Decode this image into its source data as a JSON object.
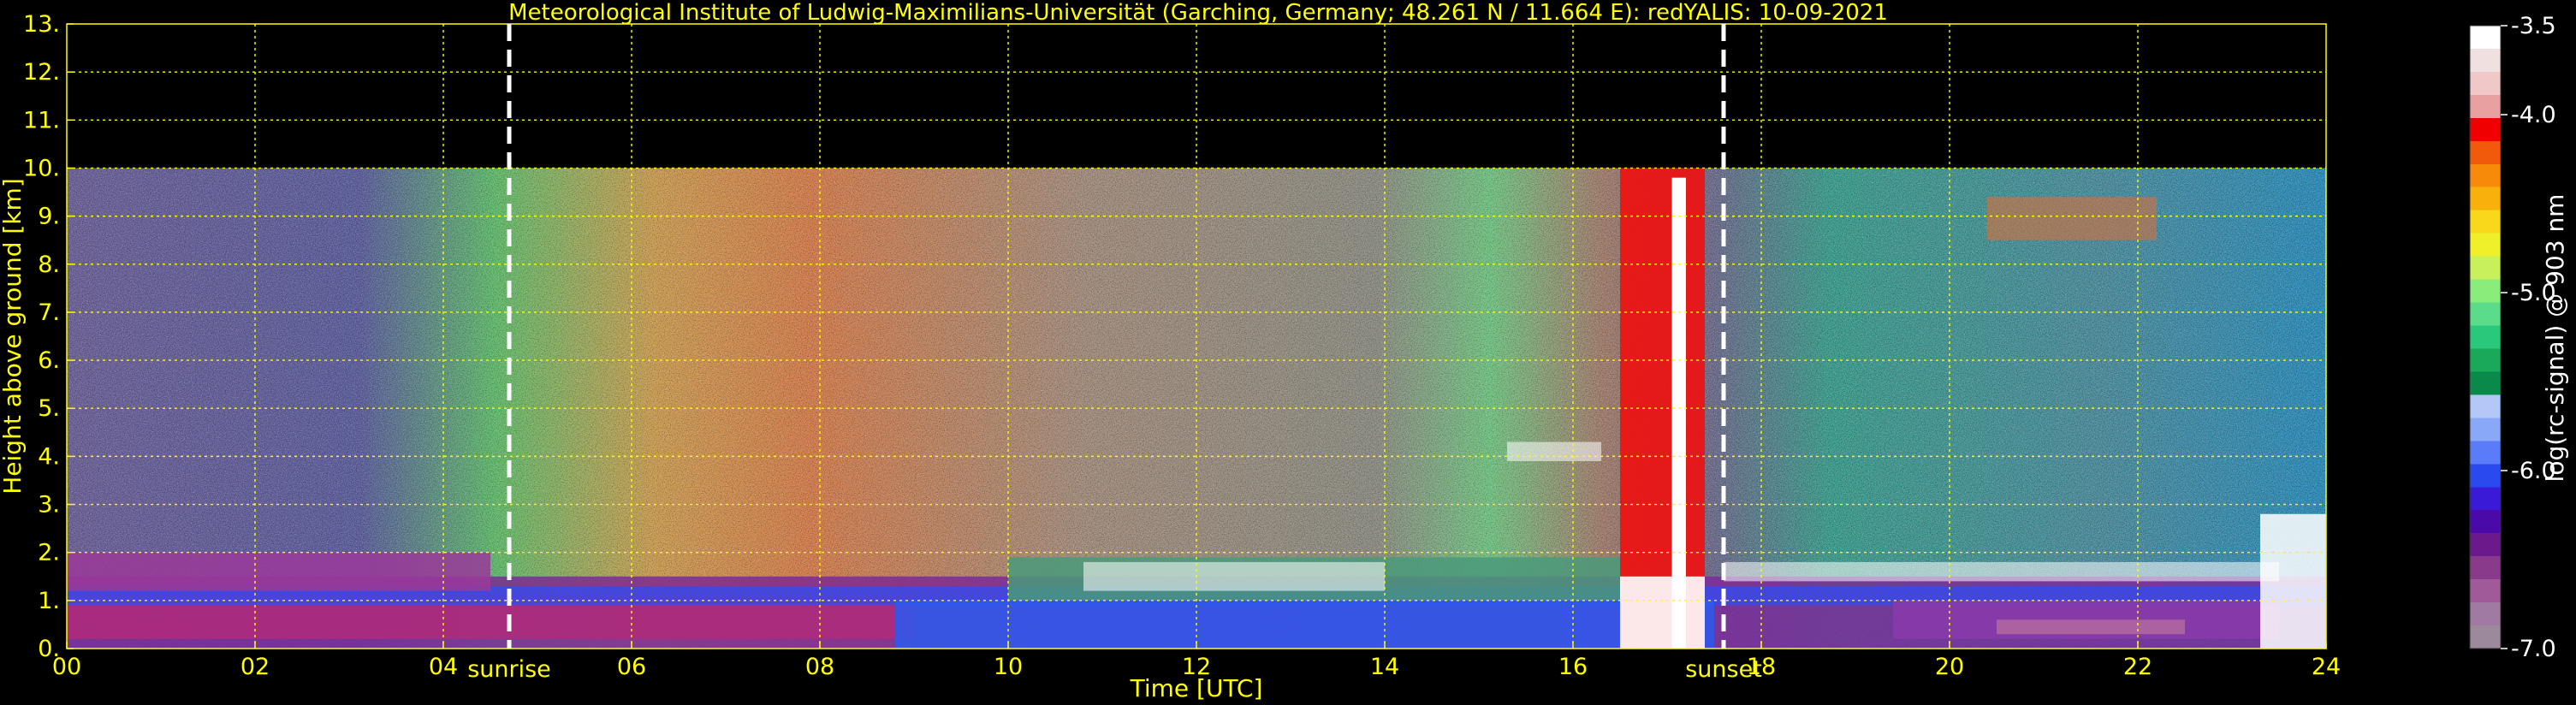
{
  "colors": {
    "background": "#000000",
    "text": "#ffff00",
    "grid": "#ffff00",
    "marker_line": "#ffffff",
    "colorbar_label": "#ffffff"
  },
  "chart_data": {
    "type": "heatmap",
    "title": "Meteorological Institute of Ludwig-Maximilians-Universität (Garching, Germany; 48.261 N / 11.664 E):    redYALIS: 10-09-2021",
    "xlabel": "Time [UTC]",
    "ylabel": "Height above ground [km]",
    "xlim": [
      0,
      24
    ],
    "ylim": [
      0,
      13
    ],
    "x_ticks": [
      "00",
      "02",
      "04",
      "06",
      "08",
      "10",
      "12",
      "14",
      "16",
      "18",
      "20",
      "22",
      "24"
    ],
    "y_ticks": [
      "0.",
      "1.",
      "2.",
      "3.",
      "4.",
      "5.",
      "6.",
      "7.",
      "8.",
      "9.",
      "10.",
      "11.",
      "12.",
      "13."
    ],
    "grid": true,
    "measurement_top_km": 10,
    "annotations": [
      {
        "label": "sunrise",
        "time": 4.7
      },
      {
        "label": "sunset",
        "time": 17.6
      }
    ],
    "colorbar": {
      "label": "log(rc-signal) @ 903 nm",
      "range": [
        -7.0,
        -3.5
      ],
      "tick_labels": [
        "-3.5",
        "-4.0",
        "-5.0",
        "-6.0",
        "-7.0"
      ],
      "tick_values": [
        -3.5,
        -4.0,
        -5.0,
        -6.0,
        -7.0
      ],
      "colors_bottom_to_top": [
        "#9c8a9c",
        "#a07aa0",
        "#a05a9a",
        "#8a3a8a",
        "#6a1a8a",
        "#4a0aaa",
        "#3a1ad6",
        "#2a4af0",
        "#5a7cf8",
        "#8aa8f8",
        "#b4c8f8",
        "#0a8a4a",
        "#1aa85a",
        "#2ac87a",
        "#5adc8a",
        "#8aec7a",
        "#c8f05a",
        "#f0f02a",
        "#f8d81a",
        "#f8b00a",
        "#f88a0a",
        "#f05a0a",
        "#f00000",
        "#e8a0a0",
        "#f0c8c8",
        "#f0e0e0",
        "#ffffff"
      ]
    },
    "features": [
      {
        "name": "boundary layer aerosol (log signal approx -6.5 to -6.0)",
        "time_range": [
          0,
          24
        ],
        "height_km": [
          0,
          1.5
        ]
      },
      {
        "name": "residual layer",
        "time_range": [
          0,
          4
        ],
        "height_km": [
          1.2,
          2.0
        ]
      },
      {
        "name": "clouds",
        "time_range": [
          10.8,
          14
        ],
        "height_km": [
          1.2,
          1.8
        ]
      },
      {
        "name": "cloud layer",
        "time_range": [
          15.3,
          16.3
        ],
        "height_km": [
          3.9,
          4.3
        ]
      },
      {
        "name": "thick cloud / precipitation",
        "time_range": [
          16.5,
          17.4
        ],
        "height_km": [
          0,
          10
        ]
      },
      {
        "name": "boundary layer clouds",
        "time_range": [
          17.6,
          23.5
        ],
        "height_km": [
          1.4,
          1.8
        ]
      },
      {
        "name": "high cirrus",
        "time_range": [
          20.4,
          22.2
        ],
        "height_km": [
          8.5,
          9.4
        ]
      },
      {
        "name": "low clouds / precipitation",
        "time_range": [
          23.3,
          24
        ],
        "height_km": [
          0,
          2.8
        ]
      }
    ]
  }
}
